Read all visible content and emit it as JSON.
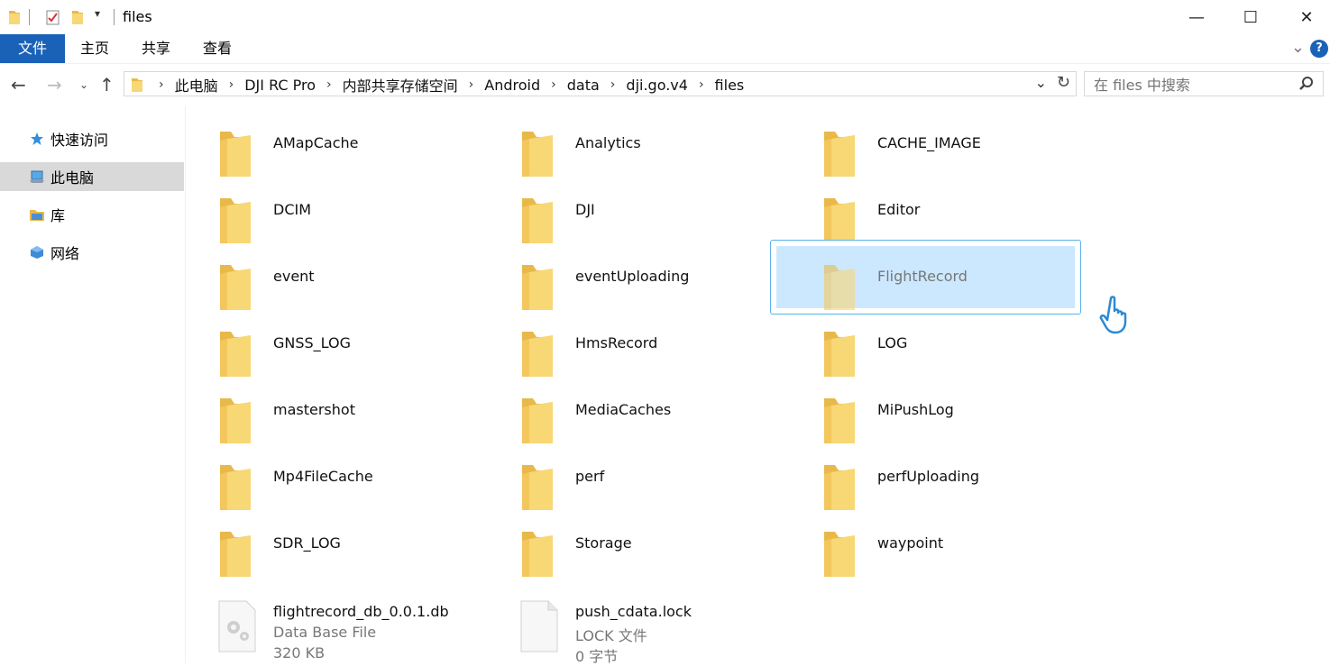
{
  "window": {
    "title": "files",
    "minimize_glyph": "—",
    "maximize_glyph": "☐",
    "close_glyph": "✕"
  },
  "ribbon": {
    "tabs": [
      "文件",
      "主页",
      "共享",
      "查看"
    ],
    "help_label": "?"
  },
  "address": {
    "crumbs": [
      "此电脑",
      "DJI RC Pro",
      "内部共享存储空间",
      "Android",
      "data",
      "dji.go.v4",
      "files"
    ]
  },
  "search": {
    "placeholder": "在 files 中搜索"
  },
  "nav": {
    "items": [
      {
        "label": "快速访问",
        "icon": "star-icon"
      },
      {
        "label": "此电脑",
        "icon": "computer-icon"
      },
      {
        "label": "库",
        "icon": "library-icon"
      },
      {
        "label": "网络",
        "icon": "network-icon"
      }
    ],
    "selected": "此电脑"
  },
  "folders": [
    "AMapCache",
    "Analytics",
    "CACHE_IMAGE",
    "DCIM",
    "DJI",
    "Editor",
    "event",
    "eventUploading",
    "FlightRecord",
    "GNSS_LOG",
    "HmsRecord",
    "LOG",
    "mastershot",
    "MediaCaches",
    "MiPushLog",
    "Mp4FileCache",
    "perf",
    "perfUploading",
    "SDR_LOG",
    "Storage",
    "waypoint"
  ],
  "selected_folder": "FlightRecord",
  "files": [
    {
      "name": "flightrecord_db_0.0.1.db",
      "type": "Data Base File",
      "size": "320 KB",
      "icon": "database-file-icon"
    },
    {
      "name": "push_cdata.lock",
      "type": "LOCK 文件",
      "size": "0 字节",
      "icon": "blank-file-icon"
    }
  ],
  "colors": {
    "accent": "#1a62b8",
    "selection_fill": "#cce8ff",
    "selection_border": "#5ab2e8",
    "folder": "#f8d775"
  }
}
